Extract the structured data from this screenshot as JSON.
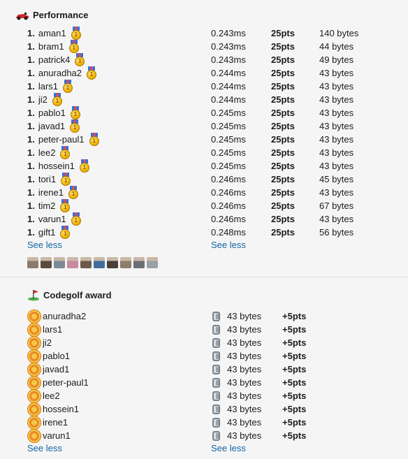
{
  "performance": {
    "icon": "race-car-icon",
    "title": "Performance",
    "rows": [
      {
        "rank": "1.",
        "name": "aman1",
        "time": "0.243ms",
        "pts": "25pts",
        "bytes": "140 bytes"
      },
      {
        "rank": "1.",
        "name": "bram1",
        "time": "0.243ms",
        "pts": "25pts",
        "bytes": "44 bytes"
      },
      {
        "rank": "1.",
        "name": "patrick4",
        "time": "0.243ms",
        "pts": "25pts",
        "bytes": "49 bytes"
      },
      {
        "rank": "1.",
        "name": "anuradha2",
        "time": "0.244ms",
        "pts": "25pts",
        "bytes": "43 bytes"
      },
      {
        "rank": "1.",
        "name": "lars1",
        "time": "0.244ms",
        "pts": "25pts",
        "bytes": "43 bytes"
      },
      {
        "rank": "1.",
        "name": "ji2",
        "time": "0.244ms",
        "pts": "25pts",
        "bytes": "43 bytes"
      },
      {
        "rank": "1.",
        "name": "pablo1",
        "time": "0.245ms",
        "pts": "25pts",
        "bytes": "43 bytes"
      },
      {
        "rank": "1.",
        "name": "javad1",
        "time": "0.245ms",
        "pts": "25pts",
        "bytes": "43 bytes"
      },
      {
        "rank": "1.",
        "name": "peter-paul1",
        "time": "0.245ms",
        "pts": "25pts",
        "bytes": "43 bytes"
      },
      {
        "rank": "1.",
        "name": "lee2",
        "time": "0.245ms",
        "pts": "25pts",
        "bytes": "43 bytes"
      },
      {
        "rank": "1.",
        "name": "hossein1",
        "time": "0.245ms",
        "pts": "25pts",
        "bytes": "43 bytes"
      },
      {
        "rank": "1.",
        "name": "tori1",
        "time": "0.246ms",
        "pts": "25pts",
        "bytes": "45 bytes"
      },
      {
        "rank": "1.",
        "name": "irene1",
        "time": "0.246ms",
        "pts": "25pts",
        "bytes": "43 bytes"
      },
      {
        "rank": "1.",
        "name": "tim2",
        "time": "0.246ms",
        "pts": "25pts",
        "bytes": "67 bytes"
      },
      {
        "rank": "1.",
        "name": "varun1",
        "time": "0.246ms",
        "pts": "25pts",
        "bytes": "43 bytes"
      },
      {
        "rank": "1.",
        "name": "gift1",
        "time": "0.248ms",
        "pts": "25pts",
        "bytes": "56 bytes"
      }
    ],
    "see_less_left": "See less",
    "see_less_right": "See less",
    "avatar_colors": [
      "#8a7b6e",
      "#5b4a3e",
      "#7d8a96",
      "#c98aa0",
      "#6b5a4b",
      "#3e6e9e",
      "#4a4038",
      "#8e7d6c",
      "#6c6f74",
      "#9aa0a6"
    ]
  },
  "codegolf": {
    "icon": "golf-flag-icon",
    "title": "Codegolf award",
    "rows": [
      {
        "name": "anuradha2",
        "bytes": "43 bytes",
        "pts": "+5pts"
      },
      {
        "name": "lars1",
        "bytes": "43 bytes",
        "pts": "+5pts"
      },
      {
        "name": "ji2",
        "bytes": "43 bytes",
        "pts": "+5pts"
      },
      {
        "name": "pablo1",
        "bytes": "43 bytes",
        "pts": "+5pts"
      },
      {
        "name": "javad1",
        "bytes": "43 bytes",
        "pts": "+5pts"
      },
      {
        "name": "peter-paul1",
        "bytes": "43 bytes",
        "pts": "+5pts"
      },
      {
        "name": "lee2",
        "bytes": "43 bytes",
        "pts": "+5pts"
      },
      {
        "name": "hossein1",
        "bytes": "43 bytes",
        "pts": "+5pts"
      },
      {
        "name": "irene1",
        "bytes": "43 bytes",
        "pts": "+5pts"
      },
      {
        "name": "varun1",
        "bytes": "43 bytes",
        "pts": "+5pts"
      }
    ],
    "see_less_left": "See less",
    "see_less_right": "See less"
  },
  "colors": {
    "link": "#1264a3",
    "text": "#1d1c1d",
    "background": "#f5f5f5"
  }
}
